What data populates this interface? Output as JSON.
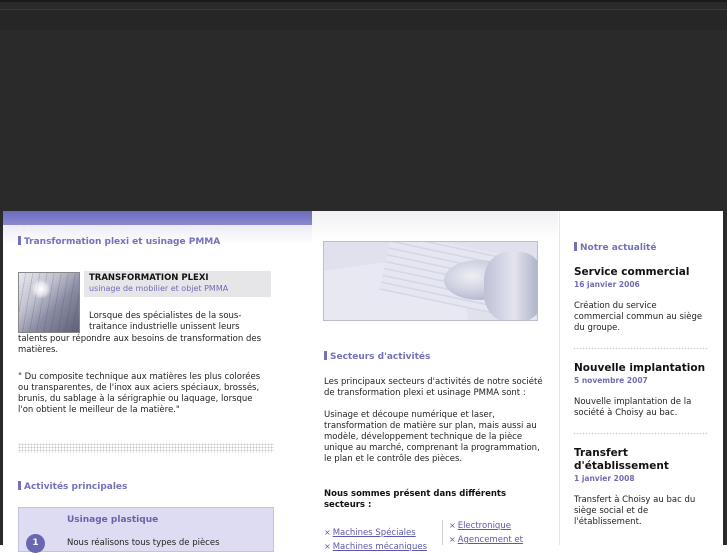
{
  "left": {
    "section_title": "Transformation plexi et usinage PMMA",
    "product_title": "TRANSFORMATION PLEXI",
    "product_subtitle": "usinage de mobilier et objet PMMA",
    "intro": [
      "Lorsque des spécialistes de la sous-",
      "traitance industrielle unissent leurs",
      "talents pour répondre aux besoins de transformation des",
      "matières."
    ],
    "quote": [
      "\" Du composite technique aux matières les plus colorées",
      "ou transparentes, de l'inox aux aciers spéciaux, brossés,",
      "brunis, du sablage à la sérigraphie ou laquage, lorsque",
      "l'on obtient le meilleur de la matière.\""
    ],
    "activities_title": "Activités principales",
    "activity": {
      "number": "1",
      "title": "Usinage plastique",
      "desc": "Nous réalisons tous types de pièces"
    }
  },
  "middle": {
    "section_title": "Secteurs d'activités",
    "p1": [
      "Les principaux secteurs d'activités de notre société",
      "de transformation plexi et usinage PMMA sont :"
    ],
    "p2": [
      "Usinage et découpe numérique et laser,",
      "transformation de matière sur plan, mais aussi au",
      "modèle, développement technique de la pièce",
      "unique au marché, comprenant la programmation,",
      "le plan et le contrôle des pièces."
    ],
    "present_title": [
      "Nous sommes présent dans différents",
      "secteurs :"
    ],
    "links_left": [
      "Machines Spéciales",
      "Machines mécaniques"
    ],
    "links_right": [
      "Electronique",
      "Agencement et"
    ]
  },
  "right": {
    "section_title": "Notre actualité",
    "news": [
      {
        "title": [
          "Service commercial"
        ],
        "date": "16 janvier 2006",
        "text": [
          "Création du service",
          "commercial commun au siège",
          "du groupe."
        ]
      },
      {
        "title": [
          "Nouvelle implantation"
        ],
        "date": "5 novembre 2007",
        "text": [
          "Nouvelle implantation de la",
          "société à Choisy au bac."
        ]
      },
      {
        "title": [
          "Transfert",
          "d'établissement"
        ],
        "date": "1 janvier 2008",
        "text": [
          "Transfert à Choisy au bac du",
          "siège social et de",
          "l'établissement."
        ]
      }
    ]
  },
  "colors": {
    "accent": "#7471b8",
    "header_band": "#2a2a2a",
    "activity_box": "#dedcf2"
  }
}
